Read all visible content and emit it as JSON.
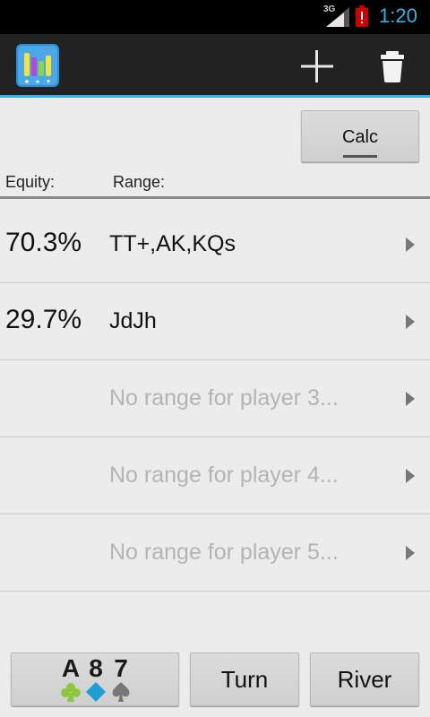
{
  "status_bar": {
    "network": "3G",
    "time": "1:20"
  },
  "action_bar": {
    "app_icon": "equity-chart-icon",
    "add_icon": "plus-icon",
    "delete_icon": "trash-icon"
  },
  "calc_button": {
    "label": "Calc"
  },
  "headers": {
    "equity": "Equity:",
    "range": "Range:"
  },
  "rows": [
    {
      "equity": "70.3%",
      "range": "TT+,AK,KQs"
    },
    {
      "equity": "29.7%",
      "range": "JdJh"
    },
    {
      "equity": "",
      "range": "No range for player 3..."
    },
    {
      "equity": "",
      "range": "No range for player 4..."
    },
    {
      "equity": "",
      "range": "No range for player 5..."
    }
  ],
  "bottom_bar": {
    "flop_cards": [
      {
        "rank": "A",
        "suit": "clubs",
        "color": "#8dc63f"
      },
      {
        "rank": "8",
        "suit": "diamonds",
        "color": "#1e9fd6"
      },
      {
        "rank": "7",
        "suit": "spades",
        "color": "#777777"
      }
    ],
    "turn_label": "Turn",
    "river_label": "River"
  },
  "colors": {
    "accent": "#33b5e5",
    "background": "#ececec",
    "actionbar": "#222222"
  }
}
